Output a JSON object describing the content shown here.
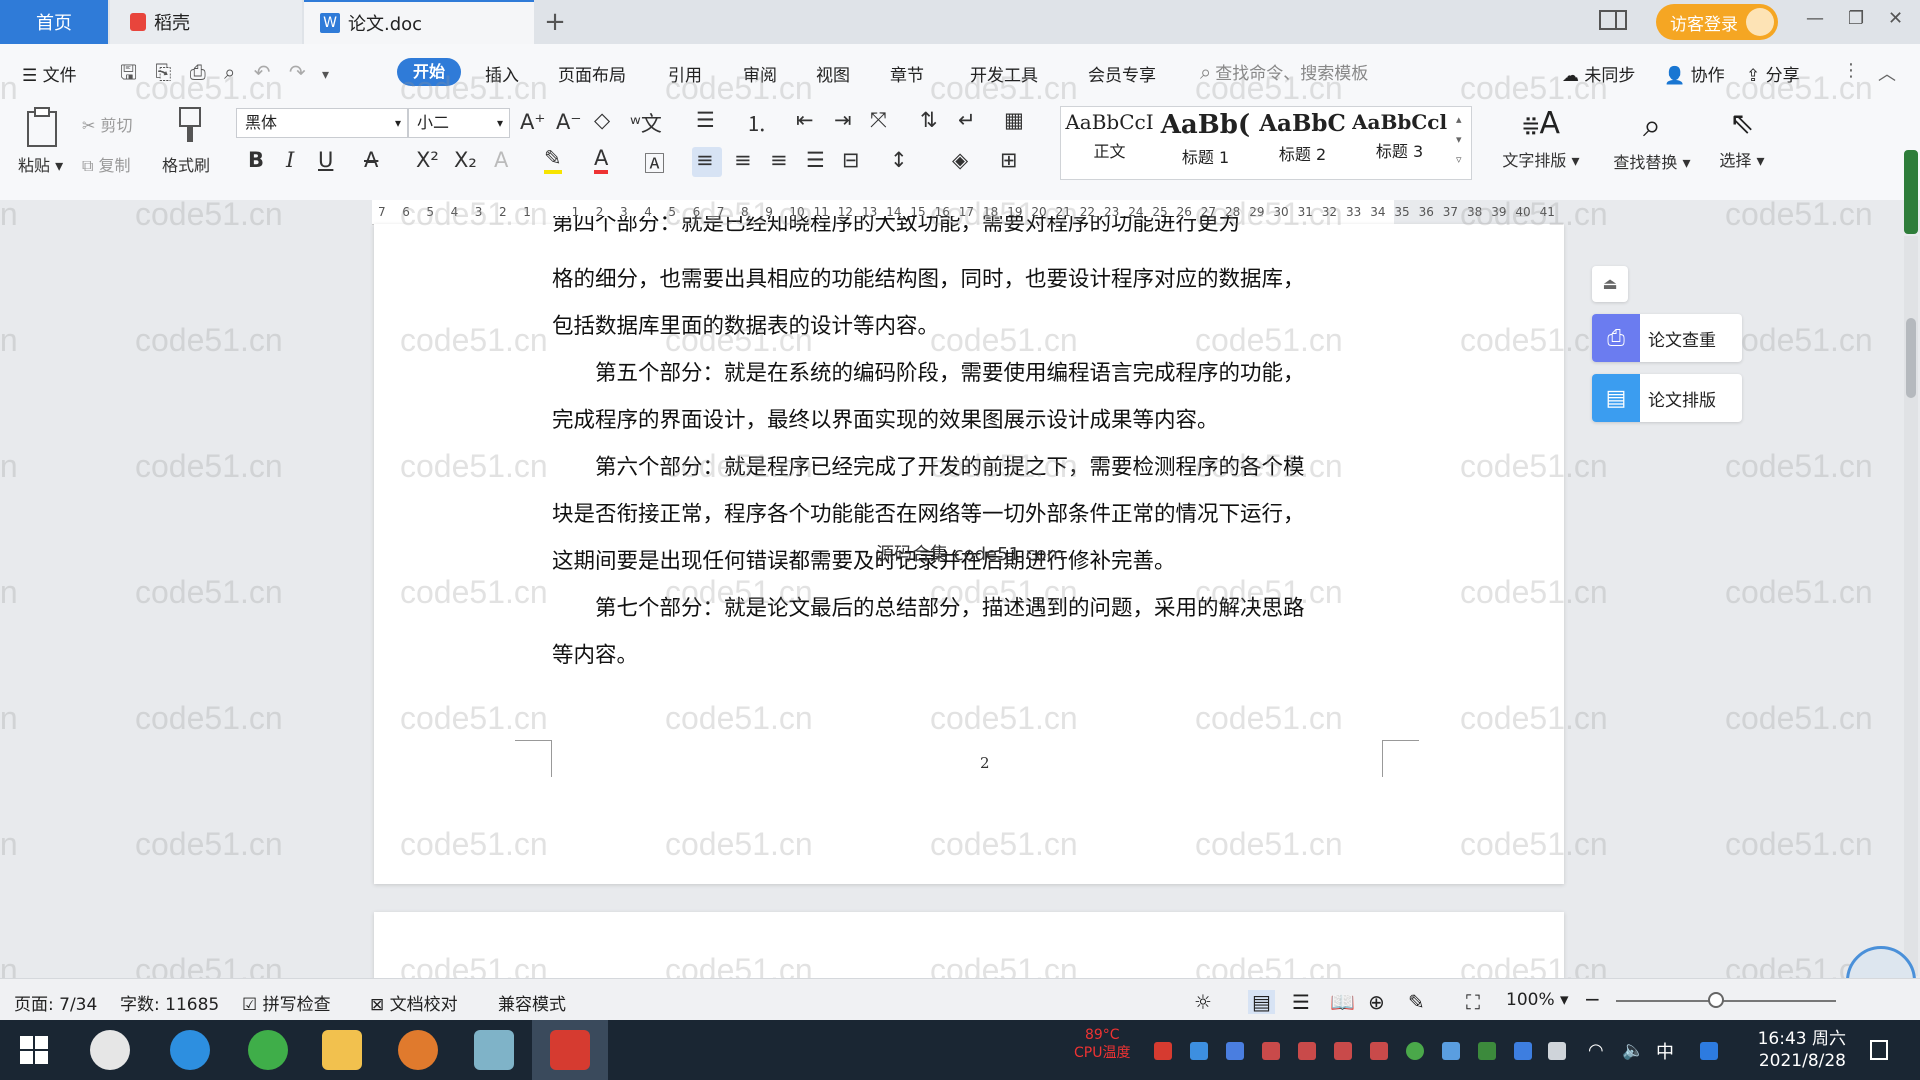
{
  "tabs": {
    "home": "首页",
    "daoke": "稻壳",
    "document": "论文.doc",
    "new_tab": "+"
  },
  "header_right": {
    "visitor_login": "访客登录"
  },
  "menu": {
    "file": "文件",
    "start": "开始",
    "insert": "插入",
    "page_layout": "页面布局",
    "reference": "引用",
    "review": "审阅",
    "view": "视图",
    "chapter": "章节",
    "dev_tools": "开发工具",
    "member": "会员专享",
    "search_placeholder": "查找命令、搜索模板",
    "not_synced": "未同步",
    "collab": "协作",
    "share": "分享"
  },
  "ribbon": {
    "paste": "粘贴",
    "cut": "剪切",
    "copy": "复制",
    "format_painter": "格式刷",
    "font_name": "黑体",
    "font_size": "小二",
    "styles": [
      {
        "sample": "AaBbCcI",
        "label": "正文"
      },
      {
        "sample": "AaBb(",
        "label": "标题 1"
      },
      {
        "sample": "AaBbC",
        "label": "标题 2"
      },
      {
        "sample": "AaBbCcl",
        "label": "标题 3"
      }
    ],
    "text_layout": "文字排版",
    "find_replace": "查找替换",
    "select": "选择"
  },
  "ruler": {
    "ticks": [
      "7",
      "6",
      "5",
      "4",
      "3",
      "2",
      "1",
      "",
      "1",
      "2",
      "3",
      "4",
      "5",
      "6",
      "7",
      "8",
      "9",
      "10",
      "11",
      "12",
      "13",
      "14",
      "15",
      "16",
      "17",
      "18",
      "19",
      "20",
      "21",
      "22",
      "23",
      "24",
      "25",
      "26",
      "27",
      "28",
      "29",
      "30",
      "31",
      "32",
      "33",
      "34",
      "35",
      "36",
      "37",
      "38",
      "39",
      "40",
      "41"
    ]
  },
  "document": {
    "partial_top": "第四个部分：就是已经知晓程序的大致功能，需要对程序的功能进行更为",
    "lines": [
      "格的细分，也需要出具相应的功能结构图，同时，也要设计程序对应的数据库，",
      "包括数据库里面的数据表的设计等内容。",
      "　　第五个部分：就是在系统的编码阶段，需要使用编程语言完成程序的功能，",
      "完成程序的界面设计，最终以界面实现的效果图展示设计成果等内容。",
      "　　第六个部分：就是程序已经完成了开发的前提之下，需要检测程序的各个模",
      "块是否衔接正常，程序各个功能能否在网络等一切外部条件正常的情况下运行，",
      "这期间要是出现任何错误都需要及时记录并在后期进行修补完善。",
      "　　第七个部分：就是论文最后的总结部分，描述遇到的问题，采用的解决思路",
      "等内容。"
    ],
    "overlay_text": "源码合集 code51.com",
    "page_number": "2"
  },
  "watermark": "code51.cn",
  "side_panel": {
    "check": "论文查重",
    "layout": "论文排版"
  },
  "status": {
    "page": "页面: 7/34",
    "words": "字数: 11685",
    "spell_check": "拼写检查",
    "doc_proof": "文档校对",
    "compat": "兼容模式",
    "zoom": "100%"
  },
  "taskbar": {
    "cpu_temp": "89°C",
    "cpu_label": "CPU温度",
    "ime": "中",
    "time": "16:43 周六",
    "date": "2021/8/28"
  },
  "colors": {
    "accent": "#2f7bd8",
    "visitor": "#f5a623",
    "taskbar": "#1a2633"
  }
}
